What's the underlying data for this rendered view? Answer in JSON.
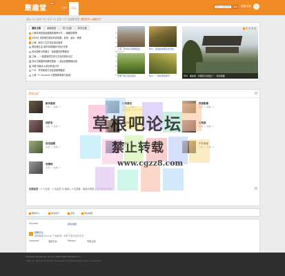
{
  "header": {
    "logo": "聚趣堂",
    "logo_badge": "BBS",
    "nav": [
      {
        "label": "门户",
        "active": false
      },
      {
        "label": "论坛",
        "active": true
      }
    ],
    "search_placeholder": "请输入搜索内容",
    "search_button": "搜索",
    "user_links": [
      "设置",
      "消息"
    ],
    "brand_color": "#f08a24"
  },
  "breadcrumb": {
    "text": "论坛: 15 | 帖子: 8 | 今日: 0 | 会员: 24 | 欢迎新会员: ",
    "highlight": "我的名字 | 最新帖子"
  },
  "portal": {
    "tabs": [
      {
        "label": "最新主题",
        "active": true
      },
      {
        "label": "最新回复",
        "active": false
      },
      {
        "label": "热门主题",
        "active": false
      },
      {
        "label": "精华主题",
        "active": false
      }
    ],
    "news": [
      {
        "num": "1",
        "title": "上海本地旅游经典路线推荐分享 — 聚趣堂推荐",
        "author": "TravelAn"
      },
      {
        "num": "2",
        "title": "4月5日 浙西南古镇自驾游攻略，老街、溪水、美食",
        "author": "TravelAn"
      },
      {
        "num": "3",
        "title": "上海 · 南京人文艺术区游记推荐",
        "author": "TravelAn"
      },
      {
        "num": "4",
        "title": "周末慢生活 城市景观摄影作品分享集",
        "author": "TravelAn"
      },
      {
        "num": "5",
        "title": "苏州园林中的春日 · 拙政园的四季美景",
        "author": "TravelAn"
      },
      {
        "num": "6",
        "title": "江南 — 一座座城的历史与文化的漫步记忆",
        "author": "TravelAn"
      },
      {
        "num": "7",
        "title": "苏州古典园林攻略完整版 — 建议收藏慢慢阅读",
        "author": "TravelAn"
      },
      {
        "num": "8",
        "title": "乌镇 西塘水乡游记精选分享",
        "author": "TravelAn"
      },
      {
        "num": "9",
        "title": "广州 · 早茶美食文化巡游推荐路线",
        "author": "TravelAn"
      },
      {
        "num": "10",
        "title": "上海 · E Gourmet 行程推荐美食与旅游",
        "author": "TravelAn"
      }
    ],
    "thumbs": [
      {
        "caption": "上海 · 老洋房与梧桐街道"
      },
      {
        "caption": "杭州 · 西湖的春夏秋冬景色"
      },
      {
        "caption": "上海 · 秋日街道漫步"
      },
      {
        "caption": "杭州 · 一场秋雨的季节"
      }
    ],
    "feature_caption": "苏州 · 拙政园 · 中国四大名园之一 · 建议收藏",
    "slider_dots": [
      "1",
      "2",
      "3",
      "4",
      "5"
    ]
  },
  "forum": {
    "title": "Discuz!",
    "boards": [
      {
        "name": "新手报到",
        "stat": "主题: 1, 帖数: 1",
        "extra": ""
      },
      {
        "name": "分享游记",
        "stat": "主题: 1, 帖数: 1",
        "extra": "最后发表: 2014-3-21"
      },
      {
        "name": "旅游影集",
        "stat": "主题: 1, 帖数: 1",
        "extra": ""
      },
      {
        "name": "找驴友",
        "stat": "主题: 0, 帖数: 0",
        "extra": ""
      },
      {
        "name": "行动天下",
        "stat": "主题: 1, 帖数: 1",
        "extra": ""
      },
      {
        "name": "自驾游",
        "stat": "主题: 1, 帖数: 1",
        "extra": ""
      },
      {
        "name": "说说话题",
        "stat": "主题: 1, 帖数: 1",
        "extra": ""
      },
      {
        "name": "美食汇",
        "stat": "主题: 1, 帖数: 1",
        "extra": ""
      },
      {
        "name": "户外装备",
        "stat": "主题: 1, 帖数: 1",
        "extra": ""
      },
      {
        "name": "去哪玩",
        "stat": "主题: 1, 帖数: 1",
        "extra": ""
      }
    ],
    "stats_label": "在线会员 - ",
    "stats": "2 人在线 - 2 位会员 (0 隐身), 0 位游客 - 最高记录是 2 于 2014-3-21"
  },
  "links": [
    {
      "label": "帮助中心"
    },
    {
      "label": "联系我们"
    },
    {
      "label": "友链"
    },
    {
      "label": "网站地图"
    }
  ],
  "partner": {
    "row1": "Founder",
    "row2a": "网站地图",
    "row3_title": "聚趣论坛",
    "row3_desc": "提供聚趣 Discuz! 产品新闻、软件下载与技术交流",
    "foot": [
      "Comsenz",
      "漫游平台",
      "Yeswan",
      "专用主机"
    ]
  },
  "footer": {
    "line1": "Powered by Discuz! X3.2 © 2001-2013 Comsenz Inc.",
    "line2": "GMT+8, 2014-3-21 16:30, Processed in 0.036231 second(s), 13 queries."
  },
  "watermark": {
    "title": "草根吧论坛",
    "subtitle": "禁止转载",
    "url": "www.cgzz8.com"
  }
}
